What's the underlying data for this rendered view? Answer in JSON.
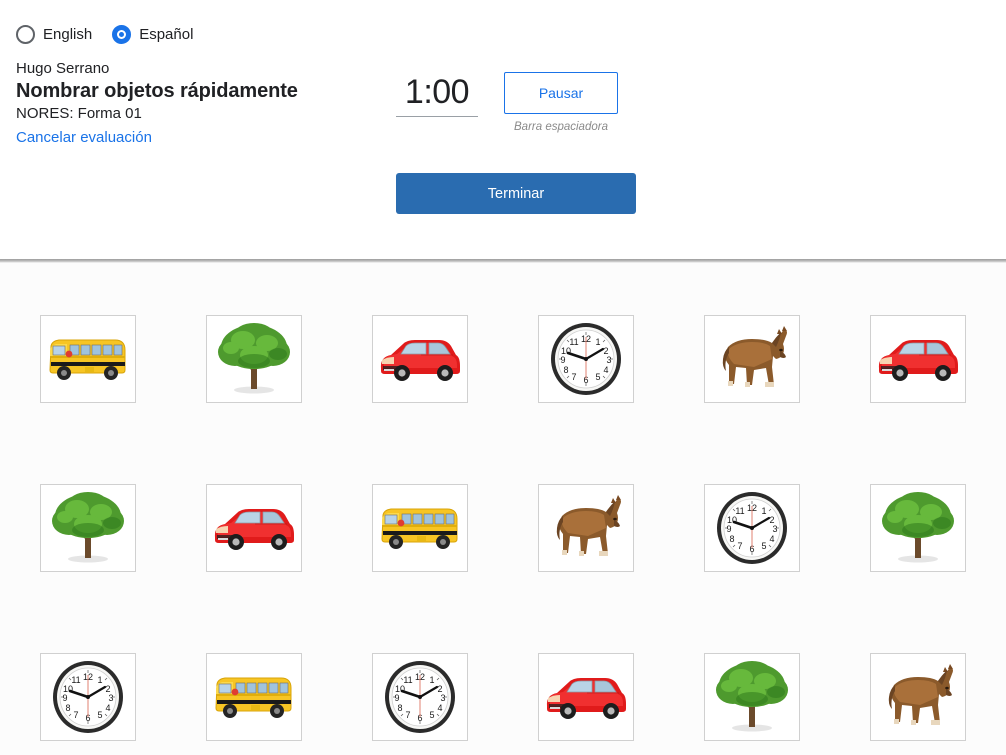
{
  "language_selector": {
    "options": [
      {
        "label": "English",
        "selected": false
      },
      {
        "label": "Español",
        "selected": true
      }
    ]
  },
  "header": {
    "student_name": "Hugo Serrano",
    "assessment_title": "Nombrar objetos rápidamente",
    "form_id": "NORES: Forma 01",
    "cancel_link": "Cancelar evaluación"
  },
  "timer": {
    "value": "1:00",
    "pause_button": "Pausar",
    "pause_hint": "Barra espaciadora"
  },
  "actions": {
    "finish_button": "Terminar"
  },
  "colors": {
    "accent_blue": "#1a73e8",
    "button_blue": "#2a6cb0",
    "grid_background": "#fcfcfc",
    "tile_border": "#d0d0d0"
  },
  "stimulus_grid": {
    "columns": 6,
    "rows": 3,
    "items": [
      "school-bus",
      "tree",
      "red-car",
      "clock",
      "horse",
      "red-car",
      "tree",
      "red-car",
      "school-bus",
      "horse",
      "clock",
      "tree",
      "clock",
      "school-bus",
      "clock",
      "red-car",
      "tree",
      "horse"
    ]
  }
}
